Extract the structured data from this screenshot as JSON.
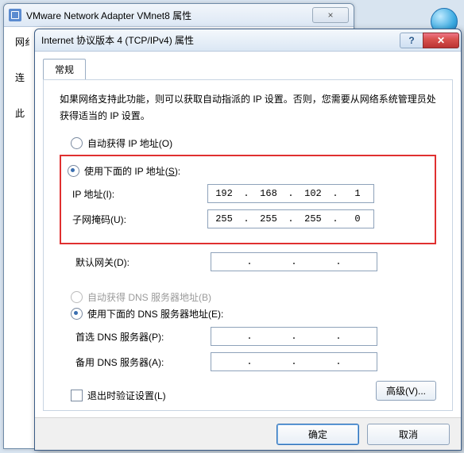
{
  "back_window": {
    "title": "VMware Network Adapter VMnet8 属性",
    "close_glyph": "×",
    "labels": {
      "net": "网纟",
      "conn": "连",
      "this": "此"
    }
  },
  "globe_text": "Internet",
  "window": {
    "title": "Internet 协议版本 4 (TCP/IPv4) 属性",
    "help_glyph": "?",
    "close_glyph": "✕"
  },
  "tab_general": "常规",
  "intro_text": "如果网络支持此功能，则可以获取自动指派的 IP 设置。否则，您需要从网络系统管理员处获得适当的 IP 设置。",
  "radios": {
    "auto_ip": "自动获得 IP 地址(O)",
    "manual_ip_prefix": "使用下面的 IP 地址(",
    "manual_ip_key": "S",
    "manual_ip_suffix": "):",
    "auto_dns": "自动获得 DNS 服务器地址(B)",
    "manual_dns": "使用下面的 DNS 服务器地址(E):"
  },
  "fields": {
    "ip_label": "IP 地址(I):",
    "mask_label": "子网掩码(U):",
    "gw_label": "默认网关(D):",
    "dns1_label": "首选 DNS 服务器(P):",
    "dns2_label": "备用 DNS 服务器(A):"
  },
  "values": {
    "ip": [
      "192",
      "168",
      "102",
      "1"
    ],
    "mask": [
      "255",
      "255",
      "255",
      "0"
    ],
    "gw": [
      "",
      "",
      "",
      ""
    ],
    "dns1": [
      "",
      "",
      "",
      ""
    ],
    "dns2": [
      "",
      "",
      "",
      ""
    ]
  },
  "dot": ".",
  "validate_label": "退出时验证设置(L)",
  "advanced_label": "高级(V)...",
  "ok_label": "确定",
  "cancel_label": "取消"
}
